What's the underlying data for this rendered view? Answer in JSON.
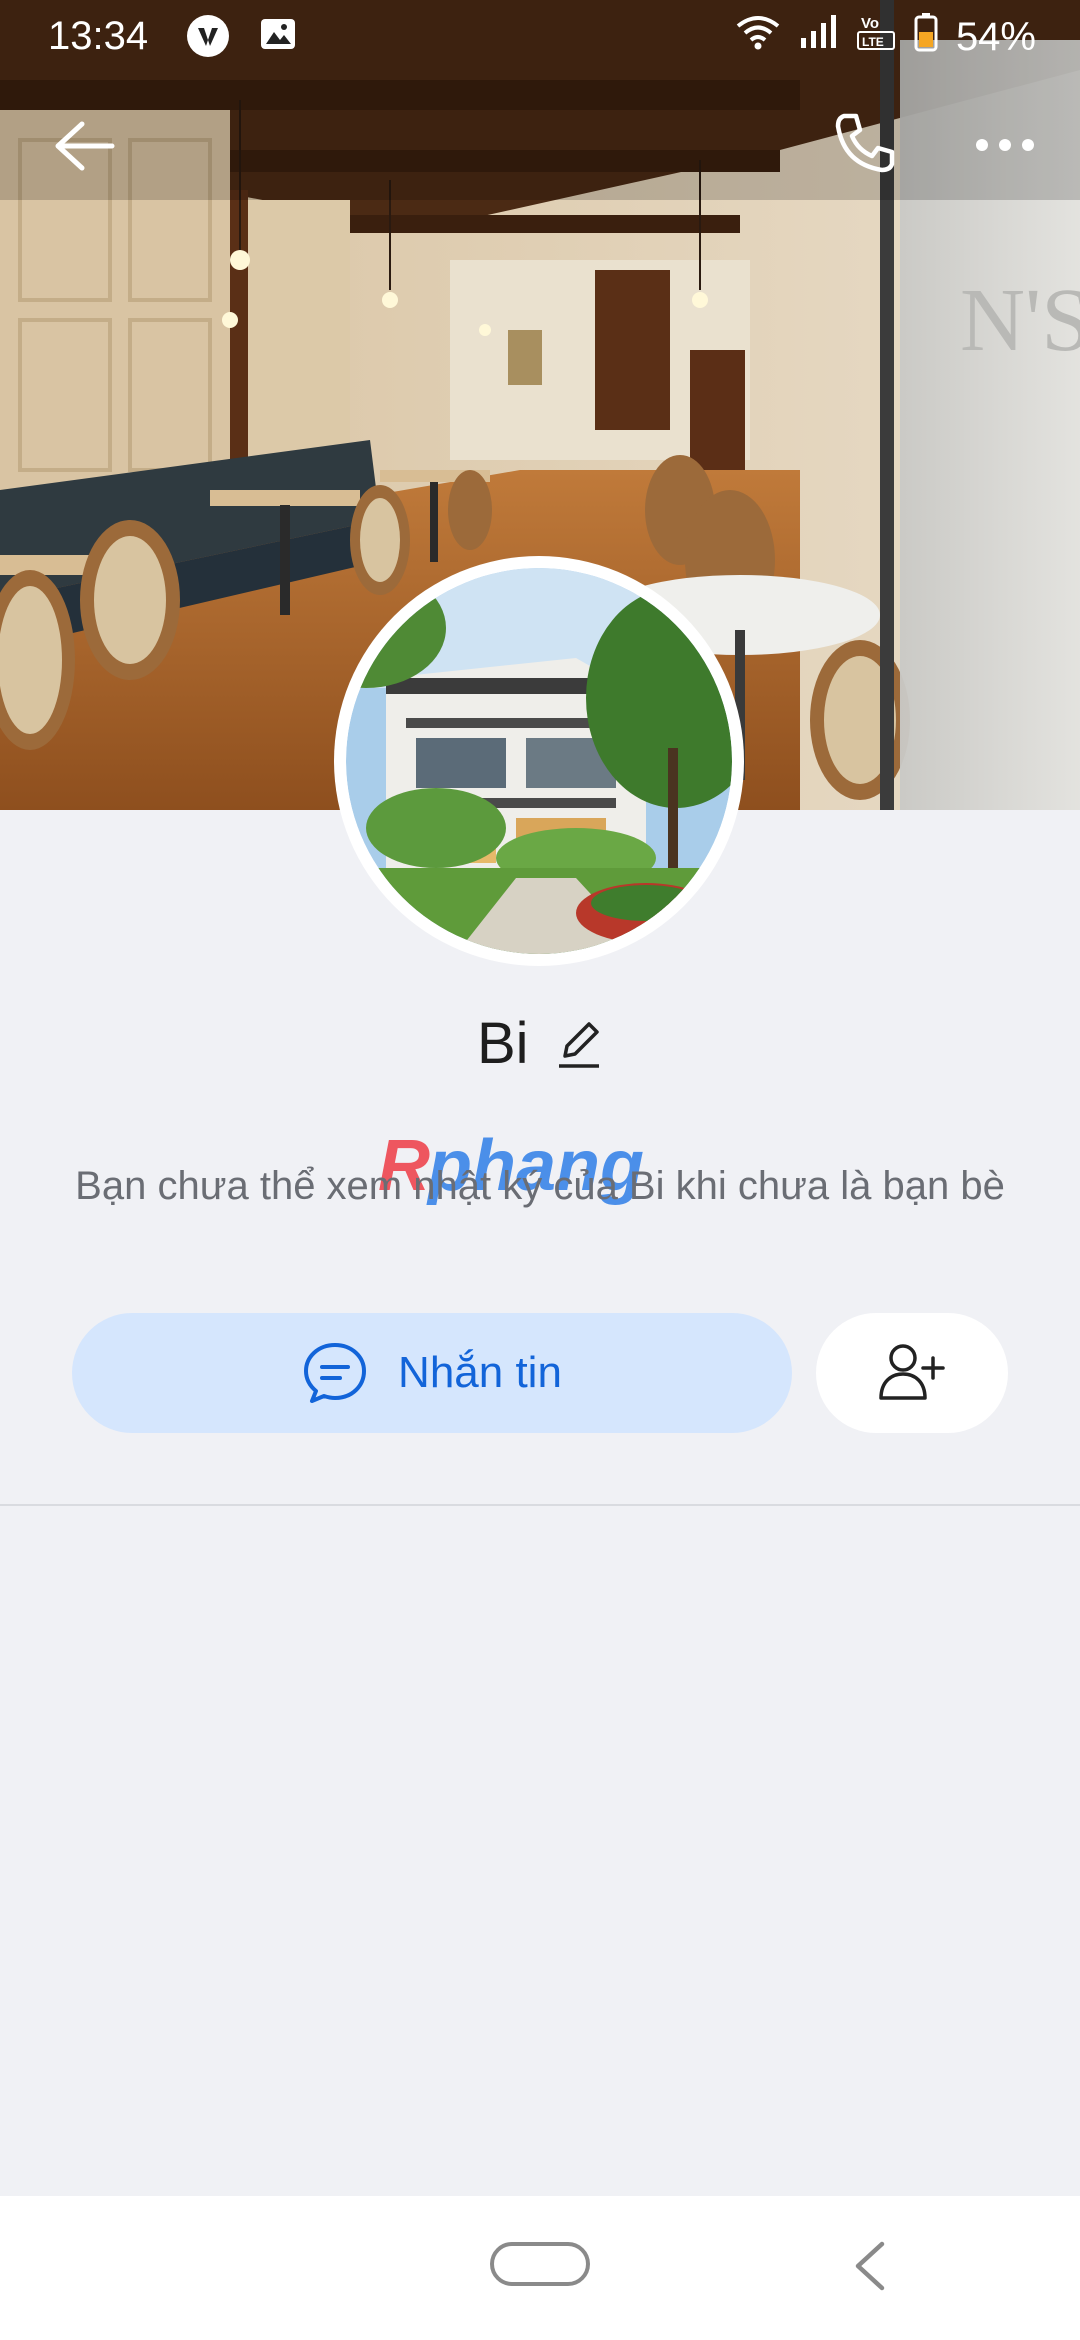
{
  "status_bar": {
    "time": "13:34",
    "left_icons": [
      "vinfast-logo-icon",
      "gallery-icon"
    ],
    "right_icons": [
      "wifi-icon",
      "signal-icon",
      "volte-icon",
      "battery-icon"
    ],
    "volte_top": "Vo",
    "volte_bottom": "LTE",
    "battery_percent": "54%"
  },
  "app_bar": {
    "icons": [
      "back-arrow-icon",
      "phone-icon",
      "more-dots-icon"
    ]
  },
  "profile": {
    "name": "Bi",
    "diary_notice": "Bạn chưa thể xem nhật ký của Bi khi chưa là bạn bè",
    "message_label": "Nhắn tin"
  },
  "watermark": {
    "text": "Rphang"
  },
  "colors": {
    "background": "#f0f1f5",
    "primary_blue": "#1264d9",
    "message_button_bg": "#d5e6fd",
    "nav_bar_bg": "#ffffff"
  }
}
